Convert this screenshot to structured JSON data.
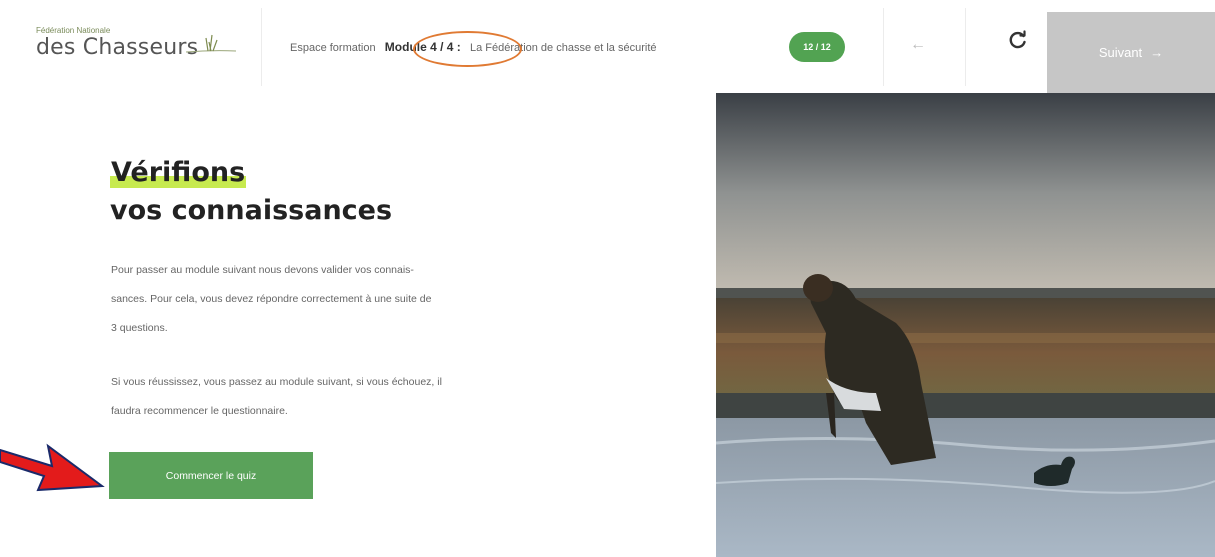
{
  "header": {
    "logo_small": "Fédération Nationale",
    "logo_big": "des Chasseurs",
    "crumb_prefix": "Espace formation",
    "module_label": "Module 4 / 4 :",
    "module_title": "La Fédération de chasse et la sécurité",
    "progress_badge": "12 / 12",
    "back_arrow": "←",
    "reload_icon": "C",
    "next_label": "Suivant",
    "next_arrow": "→"
  },
  "main": {
    "title_line1": "Vérifions",
    "title_line2": "vos connaissances",
    "para1_line1": "Pour passer au module suivant nous devons valider vos connais-",
    "para1_line2": "sances. Pour cela, vous devez répondre correctement à une suite de",
    "para1_line3": "3 questions.",
    "para2_line1": "Si vous réussissez, vous passez au module suivant, si vous échouez, il",
    "para2_line2": "faudra recommencer le questionnaire.",
    "quiz_button": "Commencer le quiz"
  },
  "colors": {
    "accent_green": "#5aa25a",
    "highlight": "#c7ea4f",
    "annotation_orange": "#e07a33",
    "annotation_red": "#e31b1b",
    "next_button_bg": "#c6c6c6"
  }
}
